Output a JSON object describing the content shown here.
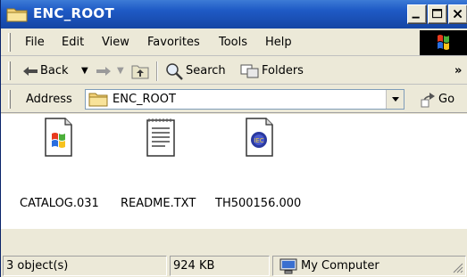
{
  "window": {
    "title": "ENC_ROOT",
    "title_icon": "folder-icon",
    "title_bar_color": "#1f5bc6",
    "controls": [
      "minimize-icon",
      "maximize-icon",
      "close-icon"
    ]
  },
  "menu": {
    "items": [
      "File",
      "Edit",
      "View",
      "Favorites",
      "Tools",
      "Help"
    ],
    "logo_icon": "windows-logo-icon"
  },
  "toolbar": {
    "back_label": "Back",
    "forward_icon": "forward-arrow-icon",
    "up_icon": "up-folder-icon",
    "search_label": "Search",
    "folders_label": "Folders",
    "overflow": "»"
  },
  "address": {
    "label": "Address",
    "value": "ENC_ROOT",
    "go_label": "Go"
  },
  "files": [
    {
      "name": "CATALOG.031",
      "icon": "application-file-icon"
    },
    {
      "name": "README.TXT",
      "icon": "text-file-icon"
    },
    {
      "name": "TH500156.000",
      "icon": "iec-file-icon"
    }
  ],
  "status": {
    "objects": "3 object(s)",
    "size": "924 KB",
    "location": "My Computer",
    "location_icon": "my-computer-icon"
  }
}
